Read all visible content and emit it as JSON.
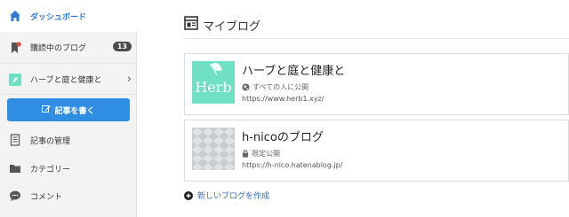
{
  "sidebar": {
    "dashboard": "ダッシュボード",
    "reading": "購読中のブログ",
    "reading_count": "13",
    "blog_name": "ハーブと庭と健康と",
    "write_button": "記事を書く",
    "manage": "記事の管理",
    "category": "カテゴリー",
    "comment": "コメント"
  },
  "main": {
    "title": "マイブログ",
    "blogs": [
      {
        "name": "ハーブと庭と健康と",
        "thumb_text": "Herb",
        "visibility": "すべての人に公開",
        "url": "https://www.herb1.xyz/"
      },
      {
        "name": "h-nicoのブログ",
        "visibility": "限定公開",
        "url": "https://h-nico.hatenablog.jp/"
      }
    ],
    "new_blog": "新しいブログを作成"
  },
  "colors": {
    "accent": "#2f8ee3",
    "herb_thumb": "#6fe0c4"
  }
}
